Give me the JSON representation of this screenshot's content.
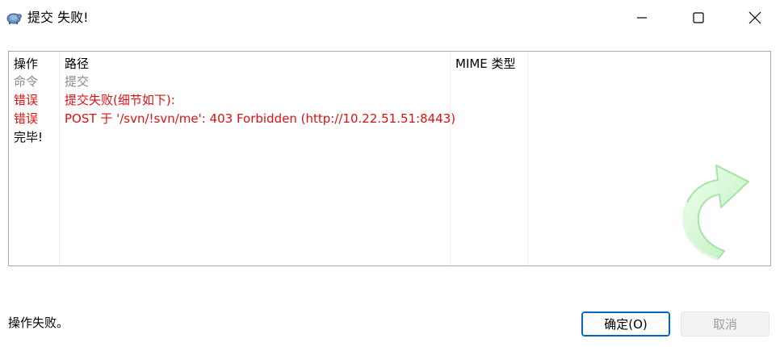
{
  "window": {
    "title": "提交 失败!"
  },
  "table": {
    "headers": {
      "action": "操作",
      "path": "路径",
      "mime": "MIME 类型"
    },
    "rows": [
      {
        "action": "命令",
        "path": "提交",
        "style": "gray"
      },
      {
        "action": "错误",
        "path": "提交失败(细节如下):",
        "style": "red"
      },
      {
        "action": "错误",
        "path": "POST 于 '/svn/!svn/me': 403 Forbidden (http://10.22.51.51:8443)",
        "style": "red"
      },
      {
        "action": "完毕!",
        "path": "",
        "style": "black"
      }
    ]
  },
  "status": {
    "text": "操作失败。"
  },
  "buttons": {
    "ok": "确定(O)",
    "cancel": "取消"
  },
  "colors": {
    "error": "#e01010",
    "muted": "#8a8a8a",
    "accent": "#0067c0",
    "arrow": "#c8f5c8"
  },
  "icons": [
    "tortoise-icon",
    "minimize-icon",
    "maximize-icon",
    "close-icon",
    "green-arrow-icon"
  ]
}
